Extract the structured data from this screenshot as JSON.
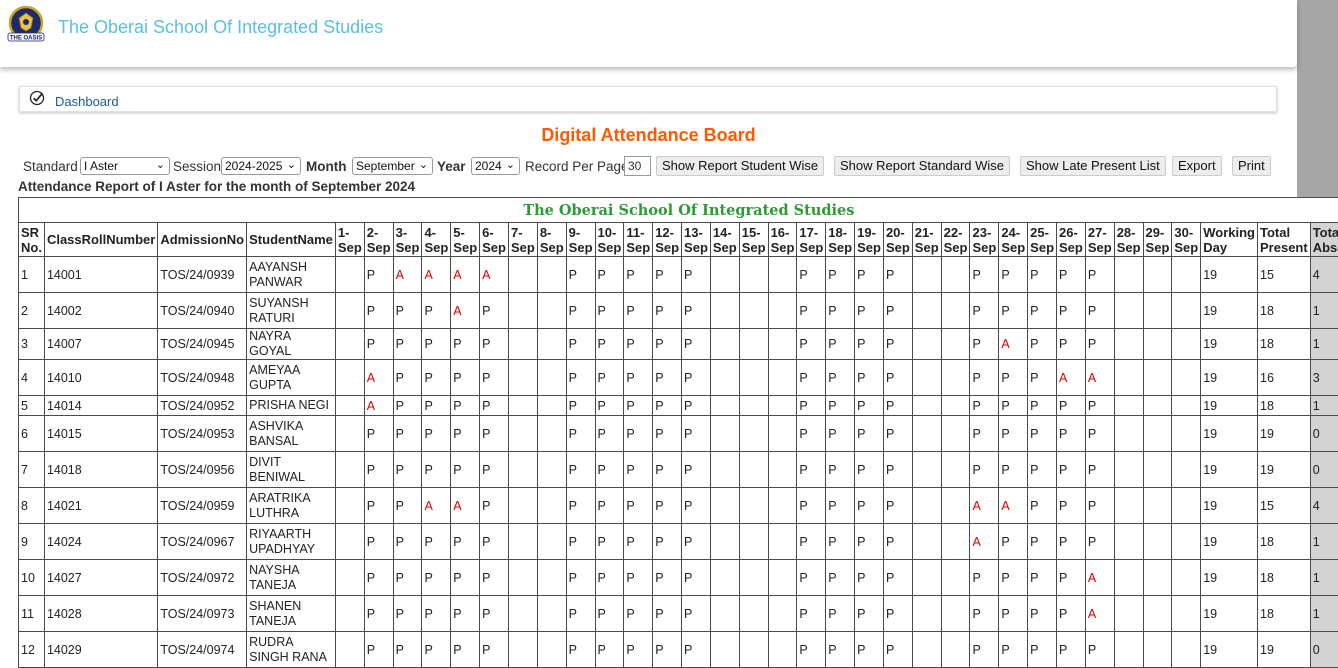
{
  "header": {
    "school_name": "The Oberai School Of Integrated Studies",
    "logo_text": "THE OASIS"
  },
  "breadcrumb": {
    "dashboard_label": "Dashboard"
  },
  "board_title": "Digital Attendance Board",
  "filters": {
    "standard_label": "Standard",
    "standard_value": "I Aster",
    "session_label": "Session",
    "session_value": "2024-2025",
    "month_label": "Month",
    "month_value": "September",
    "year_label": "Year",
    "year_value": "2024",
    "record_label": "Record Per Page",
    "record_value": "30"
  },
  "buttons": {
    "student_wise": "Show Report Student Wise",
    "standard_wise": "Show Report Standard Wise",
    "late_present": "Show Late Present List",
    "export": "Export",
    "print": "Print"
  },
  "report_title": "Attendance Report of I Aster for the month of September 2024",
  "table": {
    "banner": "The Oberai School Of Integrated Studies",
    "headers": {
      "sr": "SR No.",
      "roll": "ClassRollNumber",
      "admission": "AdmissionNo",
      "student": "StudentName",
      "days": [
        "1-Sep",
        "2-Sep",
        "3-Sep",
        "4-Sep",
        "5-Sep",
        "6-Sep",
        "7-Sep",
        "8-Sep",
        "9-Sep",
        "10-Sep",
        "11-Sep",
        "12-Sep",
        "13-Sep",
        "14-Sep",
        "15-Sep",
        "16-Sep",
        "17-Sep",
        "18-Sep",
        "19-Sep",
        "20-Sep",
        "21-Sep",
        "22-Sep",
        "23-Sep",
        "24-Sep",
        "25-Sep",
        "26-Sep",
        "27-Sep",
        "28-Sep",
        "29-Sep",
        "30-Sep"
      ],
      "working": "Working Day",
      "present": "Total Present",
      "absent": "Total Absent"
    },
    "rows": [
      {
        "sr": "1",
        "roll": "14001",
        "adm": "TOS/24/0939",
        "name": "AAYANSH PANWAR",
        "days": [
          "",
          "P",
          "A",
          "A",
          "A",
          "A",
          "",
          "",
          "P",
          "P",
          "P",
          "P",
          "P",
          "",
          "",
          "",
          "P",
          "P",
          "P",
          "P",
          "",
          "",
          "P",
          "P",
          "P",
          "P",
          "P",
          "",
          "",
          ""
        ],
        "working": "19",
        "present": "15",
        "absent": "4"
      },
      {
        "sr": "2",
        "roll": "14002",
        "adm": "TOS/24/0940",
        "name": "SUYANSH RATURI",
        "days": [
          "",
          "P",
          "P",
          "P",
          "A",
          "P",
          "",
          "",
          "P",
          "P",
          "P",
          "P",
          "P",
          "",
          "",
          "",
          "P",
          "P",
          "P",
          "P",
          "",
          "",
          "P",
          "P",
          "P",
          "P",
          "P",
          "",
          "",
          ""
        ],
        "working": "19",
        "present": "18",
        "absent": "1"
      },
      {
        "sr": "3",
        "roll": "14007",
        "adm": "TOS/24/0945",
        "name": "NAYRA GOYAL",
        "days": [
          "",
          "P",
          "P",
          "P",
          "P",
          "P",
          "",
          "",
          "P",
          "P",
          "P",
          "P",
          "P",
          "",
          "",
          "",
          "P",
          "P",
          "P",
          "P",
          "",
          "",
          "P",
          "A",
          "P",
          "P",
          "P",
          "",
          "",
          ""
        ],
        "working": "19",
        "present": "18",
        "absent": "1"
      },
      {
        "sr": "4",
        "roll": "14010",
        "adm": "TOS/24/0948",
        "name": "AMEYAA GUPTA",
        "days": [
          "",
          "A",
          "P",
          "P",
          "P",
          "P",
          "",
          "",
          "P",
          "P",
          "P",
          "P",
          "P",
          "",
          "",
          "",
          "P",
          "P",
          "P",
          "P",
          "",
          "",
          "P",
          "P",
          "P",
          "A",
          "A",
          "",
          "",
          ""
        ],
        "working": "19",
        "present": "16",
        "absent": "3"
      },
      {
        "sr": "5",
        "roll": "14014",
        "adm": "TOS/24/0952",
        "name": "PRISHA NEGI",
        "days": [
          "",
          "A",
          "P",
          "P",
          "P",
          "P",
          "",
          "",
          "P",
          "P",
          "P",
          "P",
          "P",
          "",
          "",
          "",
          "P",
          "P",
          "P",
          "P",
          "",
          "",
          "P",
          "P",
          "P",
          "P",
          "P",
          "",
          "",
          ""
        ],
        "working": "19",
        "present": "18",
        "absent": "1"
      },
      {
        "sr": "6",
        "roll": "14015",
        "adm": "TOS/24/0953",
        "name": "ASHVIKA BANSAL",
        "days": [
          "",
          "P",
          "P",
          "P",
          "P",
          "P",
          "",
          "",
          "P",
          "P",
          "P",
          "P",
          "P",
          "",
          "",
          "",
          "P",
          "P",
          "P",
          "P",
          "",
          "",
          "P",
          "P",
          "P",
          "P",
          "P",
          "",
          "",
          ""
        ],
        "working": "19",
        "present": "19",
        "absent": "0"
      },
      {
        "sr": "7",
        "roll": "14018",
        "adm": "TOS/24/0956",
        "name": "DIVIT BENIWAL",
        "days": [
          "",
          "P",
          "P",
          "P",
          "P",
          "P",
          "",
          "",
          "P",
          "P",
          "P",
          "P",
          "P",
          "",
          "",
          "",
          "P",
          "P",
          "P",
          "P",
          "",
          "",
          "P",
          "P",
          "P",
          "P",
          "P",
          "",
          "",
          ""
        ],
        "working": "19",
        "present": "19",
        "absent": "0"
      },
      {
        "sr": "8",
        "roll": "14021",
        "adm": "TOS/24/0959",
        "name": "ARATRIKA LUTHRA",
        "days": [
          "",
          "P",
          "P",
          "A",
          "A",
          "P",
          "",
          "",
          "P",
          "P",
          "P",
          "P",
          "P",
          "",
          "",
          "",
          "P",
          "P",
          "P",
          "P",
          "",
          "",
          "A",
          "A",
          "P",
          "P",
          "P",
          "",
          "",
          ""
        ],
        "working": "19",
        "present": "15",
        "absent": "4"
      },
      {
        "sr": "9",
        "roll": "14024",
        "adm": "TOS/24/0967",
        "name": "RIYAARTH UPADHYAY",
        "days": [
          "",
          "P",
          "P",
          "P",
          "P",
          "P",
          "",
          "",
          "P",
          "P",
          "P",
          "P",
          "P",
          "",
          "",
          "",
          "P",
          "P",
          "P",
          "P",
          "",
          "",
          "A",
          "P",
          "P",
          "P",
          "P",
          "",
          "",
          ""
        ],
        "working": "19",
        "present": "18",
        "absent": "1"
      },
      {
        "sr": "10",
        "roll": "14027",
        "adm": "TOS/24/0972",
        "name": "NAYSHA TANEJA",
        "days": [
          "",
          "P",
          "P",
          "P",
          "P",
          "P",
          "",
          "",
          "P",
          "P",
          "P",
          "P",
          "P",
          "",
          "",
          "",
          "P",
          "P",
          "P",
          "P",
          "",
          "",
          "P",
          "P",
          "P",
          "P",
          "A",
          "",
          "",
          ""
        ],
        "working": "19",
        "present": "18",
        "absent": "1"
      },
      {
        "sr": "11",
        "roll": "14028",
        "adm": "TOS/24/0973",
        "name": "SHANEN TANEJA",
        "days": [
          "",
          "P",
          "P",
          "P",
          "P",
          "P",
          "",
          "",
          "P",
          "P",
          "P",
          "P",
          "P",
          "",
          "",
          "",
          "P",
          "P",
          "P",
          "P",
          "",
          "",
          "P",
          "P",
          "P",
          "P",
          "A",
          "",
          "",
          ""
        ],
        "working": "19",
        "present": "18",
        "absent": "1"
      },
      {
        "sr": "12",
        "roll": "14029",
        "adm": "TOS/24/0974",
        "name": "RUDRA SINGH RANA",
        "days": [
          "",
          "P",
          "P",
          "P",
          "P",
          "P",
          "",
          "",
          "P",
          "P",
          "P",
          "P",
          "P",
          "",
          "",
          "",
          "P",
          "P",
          "P",
          "P",
          "",
          "",
          "P",
          "P",
          "P",
          "P",
          "P",
          "",
          "",
          ""
        ],
        "working": "19",
        "present": "19",
        "absent": "0"
      }
    ]
  },
  "colors": {
    "title_blue": "#5bc0de",
    "board_orange": "#ff5a00",
    "banner_green": "#2d9b34",
    "absent_red": "#e00000"
  }
}
